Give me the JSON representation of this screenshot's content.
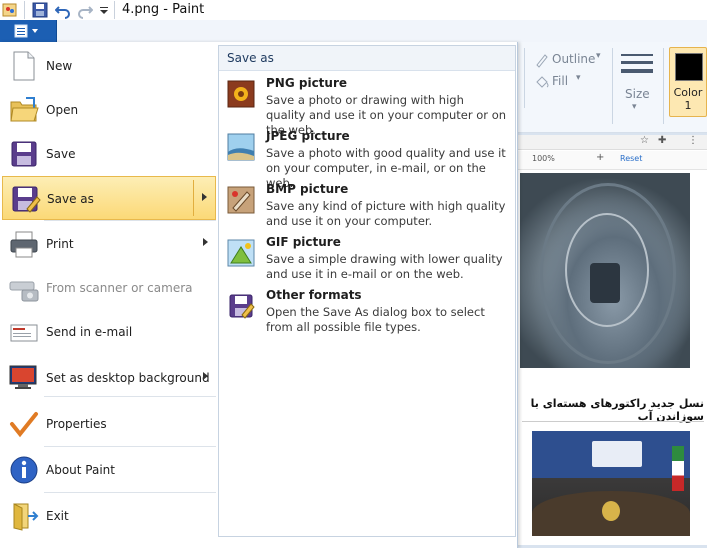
{
  "window": {
    "title": "4.png - Paint"
  },
  "ribbon": {
    "outline_label": "Outline",
    "fill_label": "Fill",
    "size_label": "Size",
    "color1_label_line1": "Color",
    "color1_label_line2": "1"
  },
  "file_menu": {
    "items": [
      {
        "label": "New"
      },
      {
        "label": "Open"
      },
      {
        "label": "Save"
      },
      {
        "label": "Save as"
      },
      {
        "label": "Print"
      },
      {
        "label": "From scanner or camera"
      },
      {
        "label": "Send in e-mail"
      },
      {
        "label": "Set as desktop background"
      },
      {
        "label": "Properties"
      },
      {
        "label": "About Paint"
      },
      {
        "label": "Exit"
      }
    ],
    "submenu": {
      "title": "Save as",
      "items": [
        {
          "title": "PNG picture",
          "desc": "Save a photo or drawing with high quality and use it on your computer or on the web."
        },
        {
          "title": "JPEG picture",
          "desc": "Save a photo with good quality and use it on your computer, in e-mail, or on the web."
        },
        {
          "title": "BMP picture",
          "desc": "Save any kind of picture with high quality and use it on your computer."
        },
        {
          "title": "GIF picture",
          "desc": "Save a simple drawing with lower quality and use it in e-mail or on the web."
        },
        {
          "title": "Other formats",
          "desc": "Open the Save As dialog box to select from all possible file types."
        }
      ]
    }
  },
  "canvas_content": {
    "zoom_text": "100%",
    "reset_text": "Reset",
    "headline": "نسل جدید راکتورهای هسته‌ای با سوزاندن آب"
  },
  "colors": {
    "file_button": "#1c5fb3",
    "hover_highlight": "#fbd977",
    "color1_value": "#000000"
  }
}
